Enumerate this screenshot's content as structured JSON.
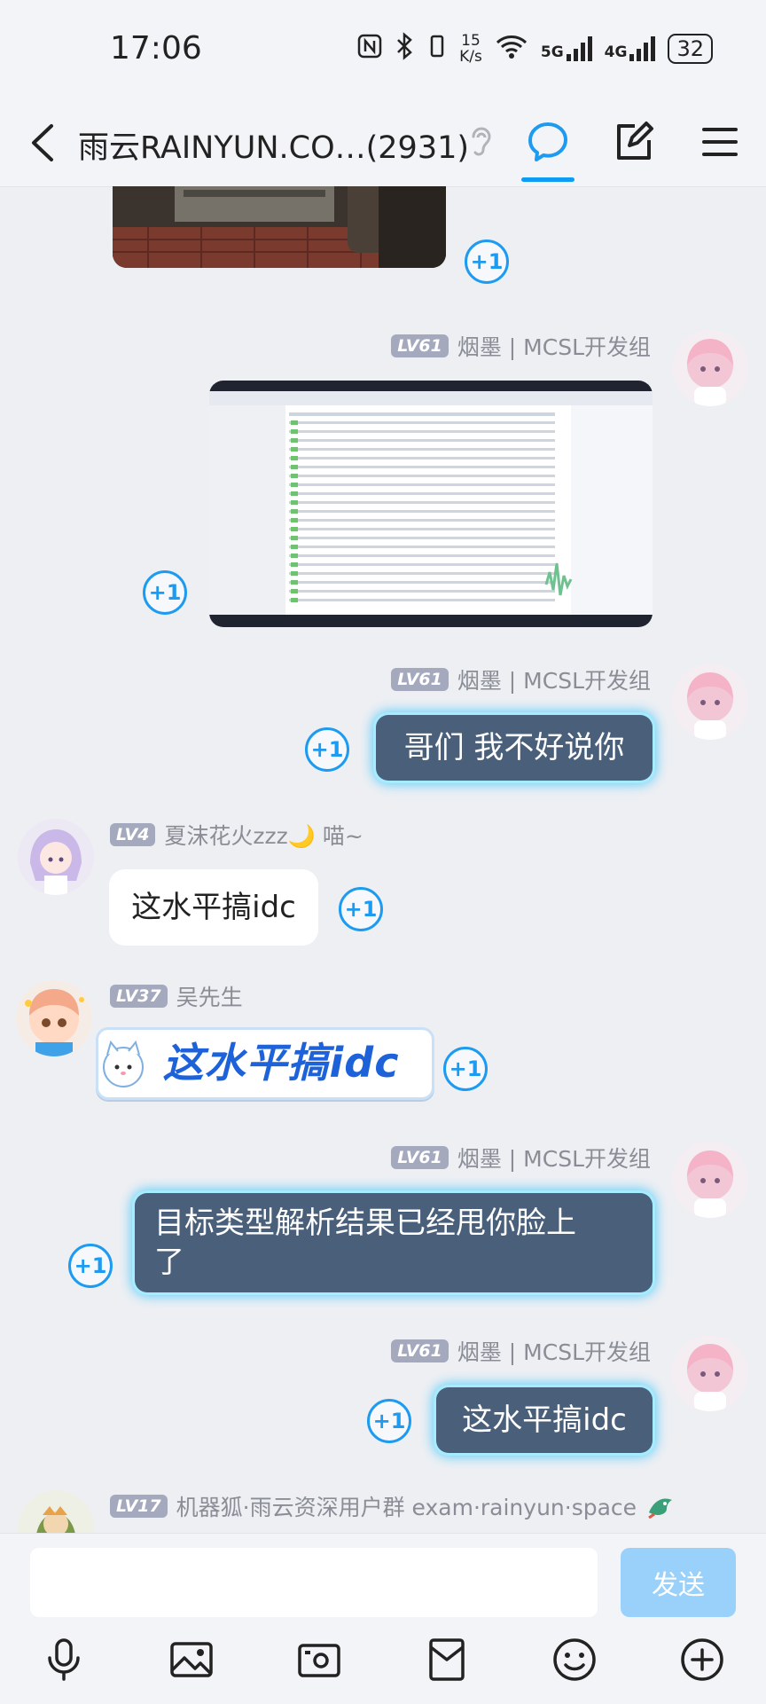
{
  "status": {
    "time": "17:06",
    "net_speed_value": "15",
    "net_speed_unit": "K/s",
    "signal1": "5G",
    "signal2": "4G",
    "battery": "32"
  },
  "header": {
    "title": "雨云RAINYUN.CO…(2931)"
  },
  "messages": [
    {
      "sender": {
        "level": "LV61",
        "name": "烟墨 | MCSL开发组"
      },
      "type": "image",
      "plus": "+1"
    },
    {
      "sender": {
        "level": "LV61",
        "name": "烟墨 | MCSL开发组"
      },
      "type": "text",
      "text": "哥们 我不好说你",
      "plus": "+1"
    },
    {
      "sender": {
        "level": "LV4",
        "name": "夏沫花火zzz🌙 喵~"
      },
      "type": "text",
      "text": "这水平搞idc",
      "plus": "+1"
    },
    {
      "sender": {
        "level": "LV37",
        "name": "吴先生"
      },
      "type": "sticker",
      "text": "这水平搞idc",
      "plus": "+1"
    },
    {
      "sender": {
        "level": "LV61",
        "name": "烟墨 | MCSL开发组"
      },
      "type": "text",
      "text_line1": "目标类型解析结果已经甩你脸上",
      "text_line2": "了",
      "plus": "+1"
    },
    {
      "sender": {
        "level": "LV61",
        "name": "烟墨 | MCSL开发组"
      },
      "type": "text",
      "text": "这水平搞idc",
      "plus": "+1"
    },
    {
      "sender": {
        "level": "LV17",
        "name": "机器狐·雨云资深用户群 exam·rainyun·space"
      }
    }
  ],
  "top_partial": {
    "plus": "+1"
  },
  "input": {
    "placeholder": "",
    "send_label": "发送"
  },
  "colors": {
    "accent": "#1d9bf0",
    "bubble_dark": "#4a5f7a",
    "bubble_glow": "#59cdfa",
    "send_disabled": "#99d1fb",
    "background": "#eeeff3"
  },
  "icons": [
    "back-icon",
    "ear-icon",
    "chat-icon",
    "edit-icon",
    "menu-icon",
    "mic-icon",
    "image-icon",
    "camera-icon",
    "red-packet-icon",
    "emoji-icon",
    "plus-icon"
  ]
}
